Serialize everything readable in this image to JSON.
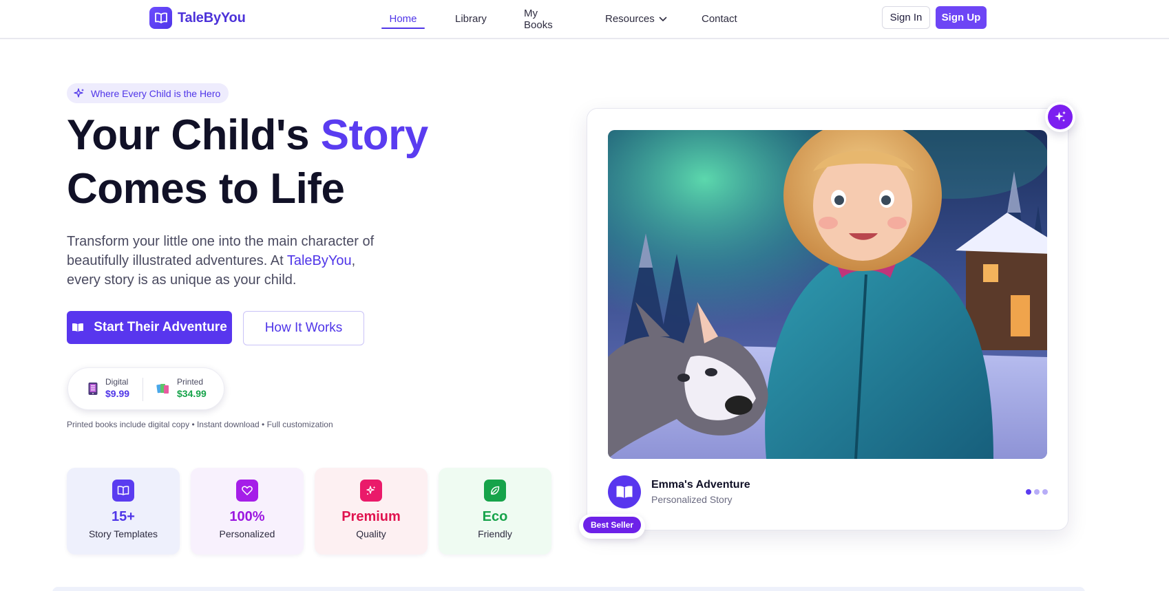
{
  "nav": {
    "brand": "TaleByYou",
    "links": {
      "home": "Home",
      "library": "Library",
      "my_books": "My Books",
      "resources": "Resources",
      "contact": "Contact"
    },
    "sign_in": "Sign In",
    "sign_up": "Sign Up"
  },
  "hero": {
    "tag": "Where Every Child is the Hero",
    "title_part1": "Your Child's ",
    "title_accent": "Story",
    "title_line2": "Comes to Life",
    "lead_before": "Transform your little one into the main character of beautifully illustrated adventures. At ",
    "lead_brand": "TaleByYou",
    "lead_after": ", every story is as unique as your child.",
    "primary_cta": "Start Their Adventure",
    "secondary_cta": "How It Works",
    "pricing": {
      "digital_label": "Digital",
      "digital_price": "$9.99",
      "printed_label": "Printed",
      "printed_price": "$34.99"
    },
    "note": "Printed books include digital copy • Instant download • Full customization",
    "stats": [
      {
        "value": "15+",
        "label": "Story Templates",
        "icon": "book-icon",
        "color": "#4f35e8"
      },
      {
        "value": "100%",
        "label": "Personalized",
        "icon": "heart-icon",
        "color": "#9b16e0"
      },
      {
        "value": "Premium",
        "label": "Quality",
        "icon": "sparkles-icon",
        "color": "#e0134f"
      },
      {
        "value": "Eco",
        "label": "Friendly",
        "icon": "leaf-icon",
        "color": "#16a34a"
      }
    ]
  },
  "showcase": {
    "image": "illustrated-girl-with-husky-under-aurora",
    "story_title": "Emma's Adventure",
    "story_subtitle": "Personalized Story",
    "badge": "Best Seller",
    "carousel_active": 1,
    "carousel_total": 3
  },
  "colors": {
    "primary": "#5836ee",
    "brand_text": "#4c32d9",
    "accent_purple": "#7c1ff0",
    "digital_price": "#4f35e8",
    "printed_price": "#16a34a"
  }
}
